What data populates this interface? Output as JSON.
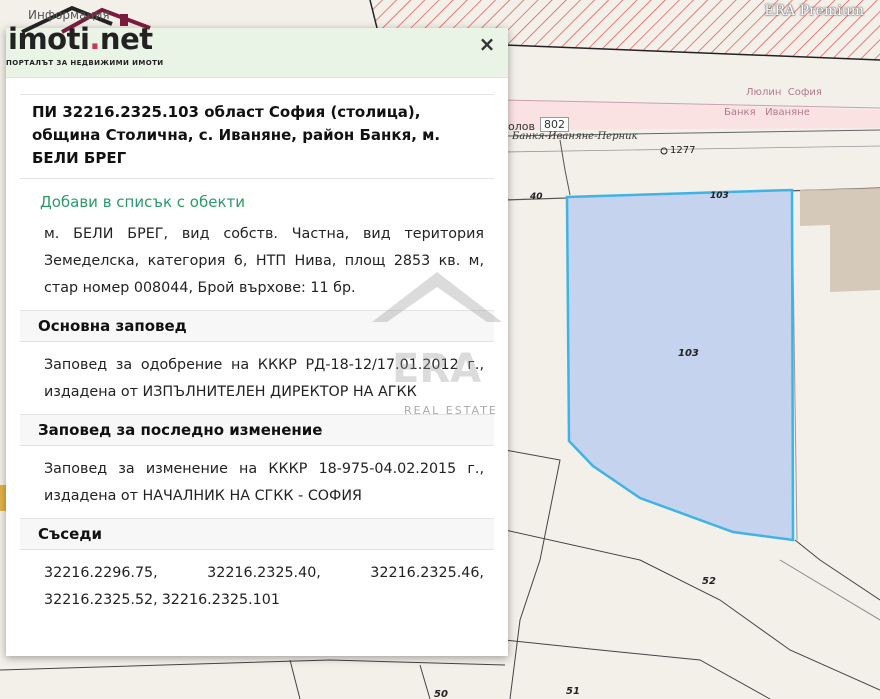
{
  "brand": "ERA Premium",
  "logo": {
    "header_word": "Информация",
    "name_left": "imoti",
    "dot": ".",
    "name_right": "net",
    "tagline": "ПОРТАЛЪТ ЗА НЕДВИЖИМИ ИМОТИ"
  },
  "panel": {
    "close_label": "×",
    "title": "ПИ 32216.2325.103 област София (столица), община Столична, с. Иваняне, район Банкя, м. БЕЛИ БРЕГ",
    "add_link": "Добави в списък с обекти",
    "description": "м. БЕЛИ БРЕГ, вид собств. Частна, вид територия Земеделска, категория 6, НТП Нива, площ 2853 кв. м, стар номер 008044, Брой върхове: 11 бр.",
    "sections": [
      {
        "heading": "Основна заповед",
        "body": "Заповед за одобрение на КККР РД-18-12/17.01.2012 г., издадена от ИЗПЪЛНИТЕЛЕН ДИРЕКТОР НА АГКК"
      },
      {
        "heading": "Заповед за последно изменение",
        "body": "Заповед за изменение на КККР 18-975-04.02.2015 г., издадена от НАЧАЛНИК НА СГКК - СОФИЯ"
      }
    ],
    "neighbors_heading": "Съседи",
    "neighbors": [
      "32216.2296.75,",
      "32216.2325.40,",
      "32216.2325.46,",
      "32216.2325.52,",
      "32216.2325.101"
    ]
  },
  "map": {
    "labels": {
      "parcel_main": "103",
      "parcel_top": "103",
      "road_40": "40",
      "road_802": "802",
      "road_name": "Банкя-Иваняне-Перник",
      "point": "1277",
      "district1": "Люлин  София",
      "district2": "Банкя   Иваняне",
      "road_prefix": "олов",
      "parcel_52": "52",
      "parcel_51": "51",
      "parcel_50": "50"
    },
    "watermark_text": "REAL ESTATE",
    "watermark_big": "ERA",
    "colors": {
      "highlight_fill": "#c6d3ef",
      "highlight_stroke": "#3fb4e4",
      "hatch": "#e24b4b"
    }
  }
}
